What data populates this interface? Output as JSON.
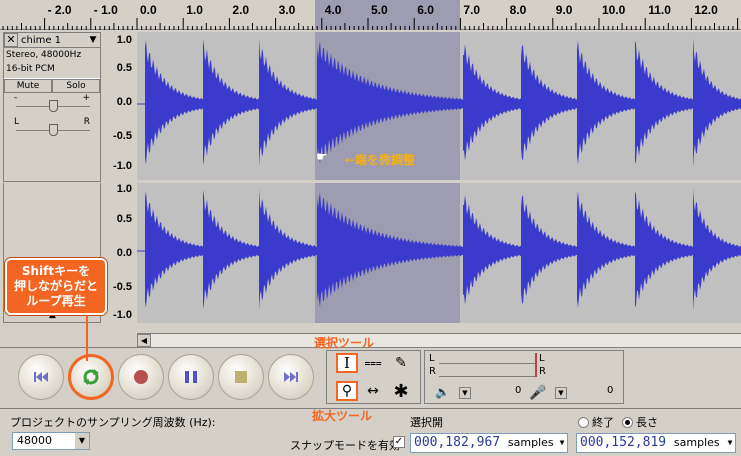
{
  "ruler": {
    "ticks": [
      "- 2.0",
      "- 1.0",
      "0.0",
      "1.0",
      "2.0",
      "3.0",
      "4.0",
      "5.0",
      "6.0",
      "7.0",
      "8.0",
      "9.0",
      "10.0",
      "11.0",
      "12.0",
      "13."
    ]
  },
  "track": {
    "name": "chime 1",
    "info_line1": "Stereo, 48000Hz",
    "info_line2": "16-bit PCM",
    "mute_label": "Mute",
    "solo_label": "Solo",
    "gain_minus": "-",
    "gain_plus": "+",
    "pan_left": "L",
    "pan_right": "R"
  },
  "scale": [
    "1.0",
    "0.5",
    "0.0",
    "-0.5",
    "-1.0"
  ],
  "annotations": {
    "edge_adjust": "←端を微調整",
    "shift_loop_line1": "Shiftキーを",
    "shift_loop_line2": "押しながらだと",
    "shift_loop_line3": "ループ再生",
    "select_tool": "選択ツール",
    "zoom_tool": "拡大ツール"
  },
  "meter": {
    "l": "L",
    "r": "R",
    "zero1": "0",
    "zero2": "0"
  },
  "bottom": {
    "rate_label": "プロジェクトのサンプリング周波数 (Hz):",
    "rate_value": "48000",
    "snap_label": "スナップモードを有効",
    "selection_start_label": "選択開",
    "end_label": "終了",
    "length_label": "長さ",
    "start_value": "000,182,967",
    "start_unit": "samples",
    "length_value": "000,152,819",
    "length_unit": "samples"
  },
  "colors": {
    "wave": "#3a3acc",
    "selection": "#9e9cb0",
    "accent": "#f26522"
  }
}
